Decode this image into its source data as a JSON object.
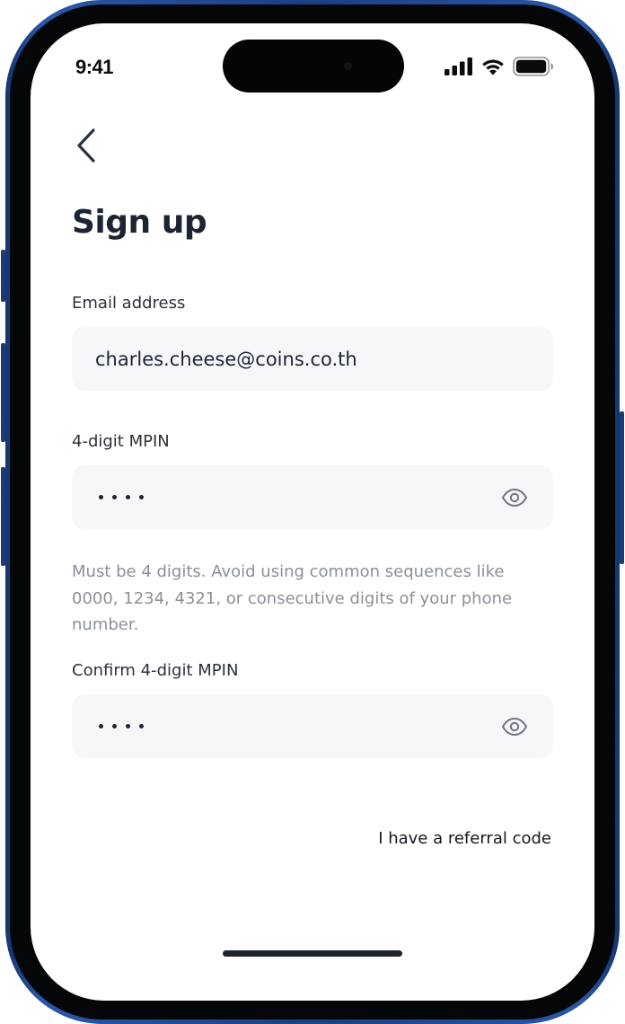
{
  "status_bar": {
    "time": "9:41"
  },
  "nav": {
    "back_icon": "chevron-left-icon"
  },
  "page": {
    "title": "Sign up"
  },
  "form": {
    "email": {
      "label": "Email address",
      "value": "charles.cheese@coins.co.th"
    },
    "mpin": {
      "label": "4-digit MPIN",
      "value_masked": "••••",
      "hint": "Must be 4 digits. Avoid using common sequences like 0000, 1234, 4321, or consecutive digits of your phone number.",
      "toggle_icon": "eye-icon"
    },
    "confirm_mpin": {
      "label": "Confirm 4-digit MPIN",
      "value_masked": "••••",
      "toggle_icon": "eye-icon"
    },
    "referral_link": "I have a referral code"
  },
  "colors": {
    "frame": "#1b3f82",
    "title": "#1c2433",
    "field_bg": "#f6f7f9",
    "hint": "#8a909a"
  }
}
